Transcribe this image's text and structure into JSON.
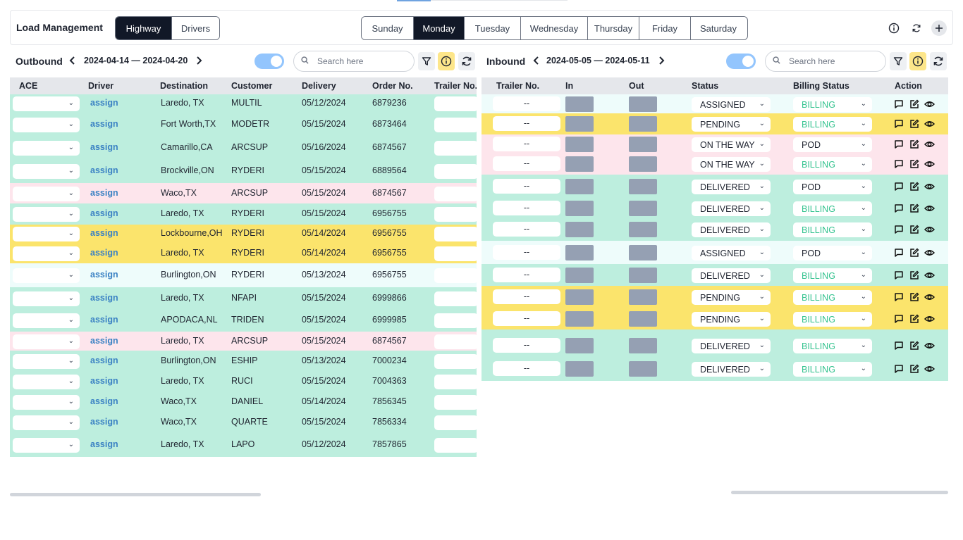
{
  "app": {
    "title": "Load Management"
  },
  "mode_tabs": [
    {
      "label": "Highway",
      "active": true
    },
    {
      "label": "Drivers",
      "active": false
    }
  ],
  "days": [
    {
      "label": "Sunday",
      "active": false
    },
    {
      "label": "Monday",
      "active": true
    },
    {
      "label": "Tuesday",
      "active": false
    },
    {
      "label": "Wednesday",
      "active": false
    },
    {
      "label": "Thursday",
      "active": false
    },
    {
      "label": "Friday",
      "active": false
    },
    {
      "label": "Saturday",
      "active": false
    }
  ],
  "top_icons": [
    "info-icon",
    "refresh-icon",
    "plus-icon"
  ],
  "outbound": {
    "title": "Outbound",
    "date_range": "2024-04-14 — 2024-04-20",
    "search_placeholder": "Search here",
    "toggle_on": true,
    "columns": [
      "ACE",
      "Driver",
      "Destination",
      "Customer",
      "Delivery",
      "Order No.",
      "Trailer No."
    ],
    "assign_label": "assign",
    "rows": [
      {
        "color": "green",
        "destination": "Laredo, TX",
        "customer": "MULTIL",
        "delivery": "05/12/2024",
        "order": "6879236"
      },
      {
        "color": "green",
        "destination": "Fort Worth,TX",
        "customer": "MODETR",
        "delivery": "05/15/2024",
        "order": "6873464"
      },
      {
        "color": "green",
        "destination": "Camarillo,CA",
        "customer": "ARCSUP",
        "delivery": "05/16/2024",
        "order": "6874567"
      },
      {
        "color": "green",
        "destination": "Brockville,ON",
        "customer": "RYDERI",
        "delivery": "05/15/2024",
        "order": "6889564"
      },
      {
        "color": "pink",
        "destination": "Waco,TX",
        "customer": "ARCSUP",
        "delivery": "05/15/2024",
        "order": "6874567"
      },
      {
        "color": "green",
        "destination": "Laredo, TX",
        "customer": "RYDERI",
        "delivery": "05/15/2024",
        "order": "6956755"
      },
      {
        "color": "yellow",
        "destination": "Lockbourne,OH",
        "customer": "RYDERI",
        "delivery": "05/14/2024",
        "order": "6956755"
      },
      {
        "color": "yellow",
        "destination": "Laredo, TX",
        "customer": "RYDERI",
        "delivery": "05/14/2024",
        "order": "6956755"
      },
      {
        "color": "light",
        "destination": "Burlington,ON",
        "customer": "RYDERI",
        "delivery": "05/13/2024",
        "order": "6956755"
      },
      {
        "color": "green",
        "destination": "Laredo, TX",
        "customer": "NFAPI",
        "delivery": "05/15/2024",
        "order": "6999866"
      },
      {
        "color": "green",
        "destination": "APODACA,NL",
        "customer": "TRIDEN",
        "delivery": "05/15/2024",
        "order": "6999985"
      },
      {
        "color": "pink",
        "destination": "Laredo, TX",
        "customer": "ARCSUP",
        "delivery": "05/15/2024",
        "order": "6874567"
      },
      {
        "color": "green",
        "destination": "Burlington,ON",
        "customer": "ESHIP",
        "delivery": "05/13/2024",
        "order": "7000234"
      },
      {
        "color": "green",
        "destination": "Laredo, TX",
        "customer": "RUCI",
        "delivery": "05/15/2024",
        "order": "7004363"
      },
      {
        "color": "green",
        "destination": "Waco,TX",
        "customer": "DANIEL",
        "delivery": "05/14/2024",
        "order": "7856345"
      },
      {
        "color": "green",
        "destination": "Waco,TX",
        "customer": "QUARTE",
        "delivery": "05/15/2024",
        "order": "7856334"
      },
      {
        "color": "green",
        "destination": "Laredo, TX",
        "customer": "LAPO",
        "delivery": "05/12/2024",
        "order": "7857865"
      }
    ]
  },
  "inbound": {
    "title": "Inbound",
    "date_range": "2024-05-05 — 2024-05-11",
    "search_placeholder": "Search here",
    "toggle_on": true,
    "columns": [
      "Trailer No.",
      "In",
      "Out",
      "Status",
      "Billing Status",
      "Action"
    ],
    "rows": [
      {
        "color": "light",
        "trailer": "--",
        "status": "ASSIGNED",
        "billing": "BILLING"
      },
      {
        "color": "yellow",
        "trailer": "--",
        "status": "PENDING",
        "billing": "BILLING"
      },
      {
        "color": "pink",
        "trailer": "--",
        "status": "ON THE WAY",
        "billing": "POD"
      },
      {
        "color": "pink",
        "trailer": "--",
        "status": "ON THE WAY",
        "billing": "BILLING"
      },
      {
        "color": "green",
        "trailer": "--",
        "status": "DELIVERED",
        "billing": "POD"
      },
      {
        "color": "green",
        "trailer": "--",
        "status": "DELIVERED",
        "billing": "BILLING"
      },
      {
        "color": "green",
        "trailer": "--",
        "status": "DELIVERED",
        "billing": "BILLING"
      },
      {
        "color": "light",
        "trailer": "--",
        "status": "ASSIGNED",
        "billing": "POD"
      },
      {
        "color": "green",
        "trailer": "--",
        "status": "DELIVERED",
        "billing": "BILLING"
      },
      {
        "color": "yellow",
        "trailer": "--",
        "status": "PENDING",
        "billing": "BILLING"
      },
      {
        "color": "yellow",
        "trailer": "--",
        "status": "PENDING",
        "billing": "BILLING"
      },
      {
        "color": "green",
        "trailer": "--",
        "status": "DELIVERED",
        "billing": "BILLING"
      },
      {
        "color": "green",
        "trailer": "--",
        "status": "DELIVERED",
        "billing": "BILLING"
      }
    ],
    "action_icons": [
      "comment-icon",
      "edit-icon",
      "view-icon"
    ]
  }
}
